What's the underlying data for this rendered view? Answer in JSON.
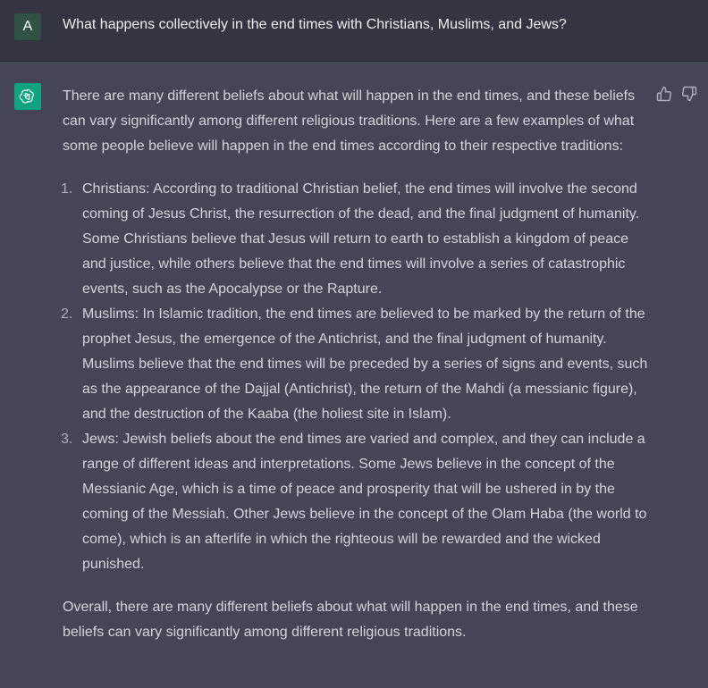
{
  "user": {
    "avatar_letter": "A",
    "message": "What happens collectively in the end times with Christians, Muslims, and Jews?"
  },
  "assistant": {
    "avatar_icon": "openai-logo-icon",
    "feedback": {
      "like_icon": "thumbs-up-icon",
      "dislike_icon": "thumbs-down-icon"
    },
    "intro": "There are many different beliefs about what will happen in the end times, and these beliefs can vary significantly among different religious traditions. Here are a few examples of what some people believe will happen in the end times according to their respective traditions:",
    "items": [
      {
        "number": "1.",
        "text": "Christians: According to traditional Christian belief, the end times will involve the second coming of Jesus Christ, the resurrection of the dead, and the final judgment of humanity. Some Christians believe that Jesus will return to earth to establish a kingdom of peace and justice, while others believe that the end times will involve a series of catastrophic events, such as the Apocalypse or the Rapture."
      },
      {
        "number": "2.",
        "text": "Muslims: In Islamic tradition, the end times are believed to be marked by the return of the prophet Jesus, the emergence of the Antichrist, and the final judgment of humanity. Muslims believe that the end times will be preceded by a series of signs and events, such as the appearance of the Dajjal (Antichrist), the return of the Mahdi (a messianic figure), and the destruction of the Kaaba (the holiest site in Islam)."
      },
      {
        "number": "3.",
        "text": "Jews: Jewish beliefs about the end times are varied and complex, and they can include a range of different ideas and interpretations. Some Jews believe in the concept of the Messianic Age, which is a time of peace and prosperity that will be ushered in by the coming of the Messiah. Other Jews believe in the concept of the Olam Haba (the world to come), which is an afterlife in which the righteous will be rewarded and the wicked punished."
      }
    ],
    "conclusion": "Overall, there are many different beliefs about what will happen in the end times, and these beliefs can vary significantly among different religious traditions."
  },
  "colors": {
    "user_bg": "#343541",
    "assistant_bg": "#444654",
    "user_avatar_bg": "#2f5242",
    "bot_avatar_bg": "#10a37f",
    "text": "#d1d5db"
  }
}
